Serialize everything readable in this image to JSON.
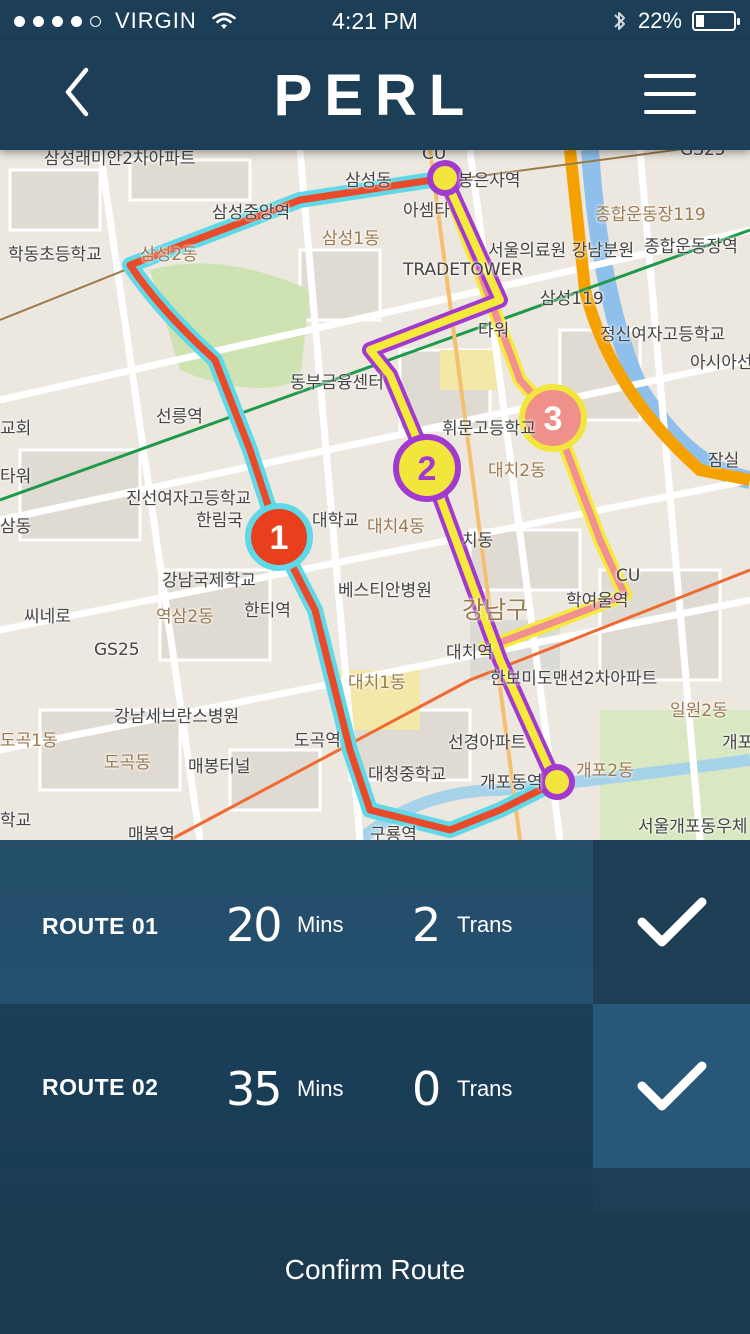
{
  "status_bar": {
    "carrier": "VIRGIN",
    "time": "4:21 PM",
    "battery": "22%",
    "battery_level": 0.22,
    "signal_bars_filled": 4,
    "signal_bars_total": 5
  },
  "header": {
    "logo": "PERL",
    "back_icon": "chevron-left-icon",
    "menu_icon": "hamburger-menu-icon"
  },
  "map": {
    "route_markers": [
      "1",
      "2",
      "3"
    ],
    "colors": {
      "route1": "#e84a2a",
      "route1_outline": "#5fd8e8",
      "route2": "#f5ea3a",
      "route2_outline": "#a23ad0",
      "route3": "#f09090",
      "route3_outline": "#f5ea3a",
      "marker1": "#e8401c",
      "marker2": "#f2e63c",
      "marker3": "#f0908a"
    },
    "labels": [
      "삼성래미안2차아파트",
      "CU",
      "GS25",
      "삼성동",
      "봉은사역",
      "종합운동장119",
      "아셈타",
      "삼성중앙역",
      "삼성2동",
      "삼성1동",
      "서울의료원 강남분원",
      "종합운동장역",
      "학동초등학교",
      "TRADETOWER",
      "삼성119",
      "정신여자고등학교",
      "타워",
      "아시아선",
      "동부금융센터",
      "선릉역",
      "휘문고등학교",
      "교회",
      "대치2동",
      "타워",
      "잠실",
      "진선여자고등학교",
      "한림국",
      "대학교",
      "대치4동",
      "치동",
      "삼동",
      "강남국제학교",
      "CU",
      "베스티안병원",
      "강남구",
      "학여울역",
      "씨네로",
      "역삼2동",
      "한티역",
      "대치역",
      "GS25",
      "한보미도맨션2차아파트",
      "대치1동",
      "강남세브란스병원",
      "일원2동",
      "도곡1동",
      "도곡역",
      "선경아파트",
      "도곡동",
      "매봉터널",
      "대청중학교",
      "개포2동",
      "개포동역",
      "개포",
      "학교",
      "매봉역",
      "구룡역",
      "서울개포동우체"
    ]
  },
  "routes": [
    {
      "name": "ROUTE 01",
      "minutes": "20",
      "minutes_unit": "Mins",
      "transfers": "2",
      "transfers_unit": "Trans",
      "check_icon": "checkmark-icon"
    },
    {
      "name": "ROUTE 02",
      "minutes": "35",
      "minutes_unit": "Mins",
      "transfers": "0",
      "transfers_unit": "Trans",
      "check_icon": "checkmark-icon"
    }
  ],
  "confirm_label": "Confirm Route"
}
